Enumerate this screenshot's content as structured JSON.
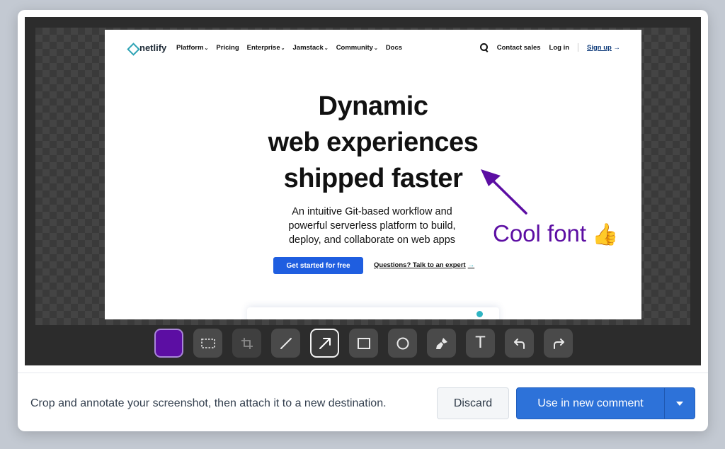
{
  "colors": {
    "annotation": "#5c0ea3",
    "primary_button": "#2d72d9",
    "netlify_blue": "#1f5ee0",
    "netlify_teal": "#2fb4c2"
  },
  "screenshot": {
    "logo_text": "netlify",
    "nav": {
      "platform": "Platform",
      "pricing": "Pricing",
      "enterprise": "Enterprise",
      "jamstack": "Jamstack",
      "community": "Community",
      "docs": "Docs",
      "contact_sales": "Contact sales",
      "log_in": "Log in",
      "sign_up": "Sign up",
      "chevron": "⌄",
      "arrow": "→"
    },
    "headline": {
      "line1": "Dynamic",
      "line2": "web experiences",
      "line3": "shipped faster"
    },
    "subhead": {
      "line1": "An intuitive Git-based workflow and",
      "line2": "powerful serverless platform to build,",
      "line3": "deploy, and collaborate on web apps"
    },
    "cta_primary": "Get started for free",
    "cta_secondary": "Questions? Talk to an expert",
    "cta_arrow": "→"
  },
  "annotation": {
    "text": "Cool font",
    "emoji": "👍"
  },
  "toolbar": {
    "selected_color": "#5c0ea3",
    "tools": [
      {
        "name": "color-swatch",
        "icon": "color-swatch"
      },
      {
        "name": "select-region",
        "icon": "dashed-rect-icon"
      },
      {
        "name": "crop",
        "icon": "crop-icon",
        "disabled": true
      },
      {
        "name": "line",
        "icon": "line-icon"
      },
      {
        "name": "arrow",
        "icon": "arrow-icon",
        "active": true
      },
      {
        "name": "rectangle",
        "icon": "rectangle-icon"
      },
      {
        "name": "ellipse",
        "icon": "circle-icon"
      },
      {
        "name": "brush",
        "icon": "brush-icon"
      },
      {
        "name": "text",
        "icon": "text-icon",
        "glyph": "T"
      },
      {
        "name": "undo",
        "icon": "undo-icon"
      },
      {
        "name": "redo",
        "icon": "redo-icon"
      }
    ]
  },
  "footer": {
    "message": "Crop and annotate your screenshot, then attach it to a new destination.",
    "discard_label": "Discard",
    "primary_label": "Use in new comment"
  }
}
